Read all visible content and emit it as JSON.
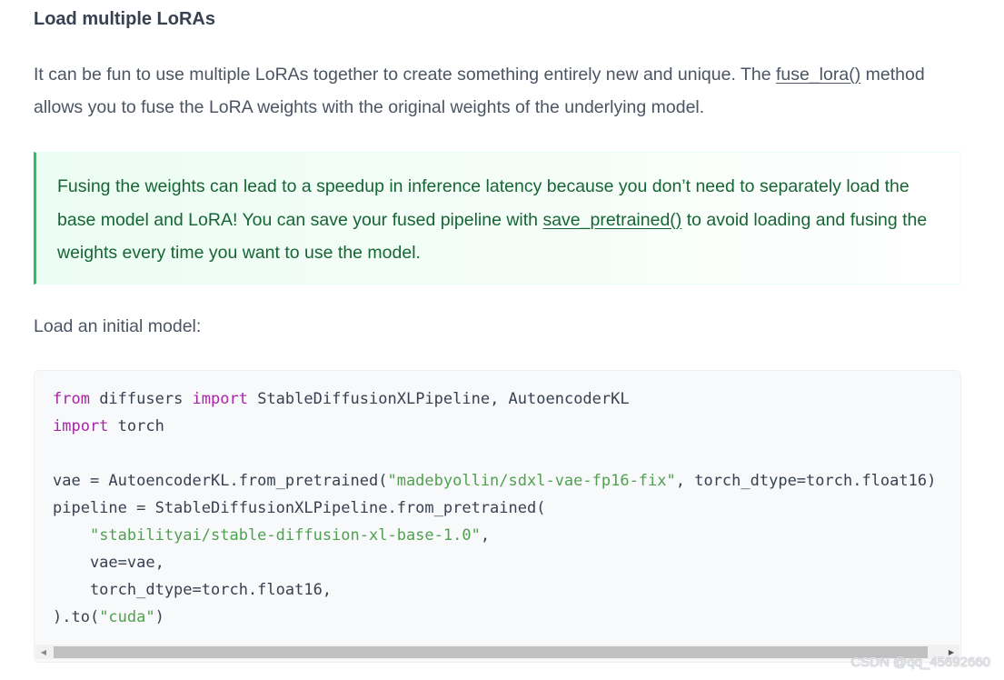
{
  "section": {
    "heading": "Load multiple LoRAs",
    "intro_before_link": "It can be fun to use multiple LoRAs together to create something entirely new and unique. The ",
    "intro_link": "fuse_lora()",
    "intro_after_link": " method allows you to fuse the LoRA weights with the original weights of the underlying model."
  },
  "tip": {
    "text_before_link": "Fusing the weights can lead to a speedup in inference latency because you don’t need to separately load the base model and LoRA! You can save your fused pipeline with ",
    "link": "save_pretrained()",
    "text_after_link": " to avoid loading and fusing the weights every time you want to use the model.",
    "accent_color": "#22c55e",
    "text_color": "#166534"
  },
  "load_text": "Load an initial model:",
  "code": {
    "lines": [
      [
        {
          "t": "from",
          "c": "kw"
        },
        {
          "t": " diffusers ",
          "c": ""
        },
        {
          "t": "import",
          "c": "kw"
        },
        {
          "t": " StableDiffusionXLPipeline, AutoencoderKL",
          "c": ""
        }
      ],
      [
        {
          "t": "import",
          "c": "kw"
        },
        {
          "t": " torch",
          "c": ""
        }
      ],
      [],
      [
        {
          "t": "vae = AutoencoderKL.from_pretrained(",
          "c": ""
        },
        {
          "t": "\"madebyollin/sdxl-vae-fp16-fix\"",
          "c": "str"
        },
        {
          "t": ", torch_dtype=torch.float16)",
          "c": ""
        }
      ],
      [
        {
          "t": "pipeline = StableDiffusionXLPipeline.from_pretrained(",
          "c": ""
        }
      ],
      [
        {
          "t": "    ",
          "c": ""
        },
        {
          "t": "\"stabilityai/stable-diffusion-xl-base-1.0\"",
          "c": "str"
        },
        {
          "t": ",",
          "c": ""
        }
      ],
      [
        {
          "t": "    vae=vae,",
          "c": ""
        }
      ],
      [
        {
          "t": "    torch_dtype=torch.float16,",
          "c": ""
        }
      ],
      [
        {
          "t": ").to(",
          "c": ""
        },
        {
          "t": "\"cuda\"",
          "c": "str"
        },
        {
          "t": ")",
          "c": ""
        }
      ]
    ],
    "keyword_color": "#a626a4",
    "string_color": "#50a14f",
    "scrollbar": {
      "left_arrow_icon": "triangle-left-icon",
      "right_arrow_icon": "triangle-right-icon"
    }
  },
  "watermark": "CSDN @qq_45692660"
}
